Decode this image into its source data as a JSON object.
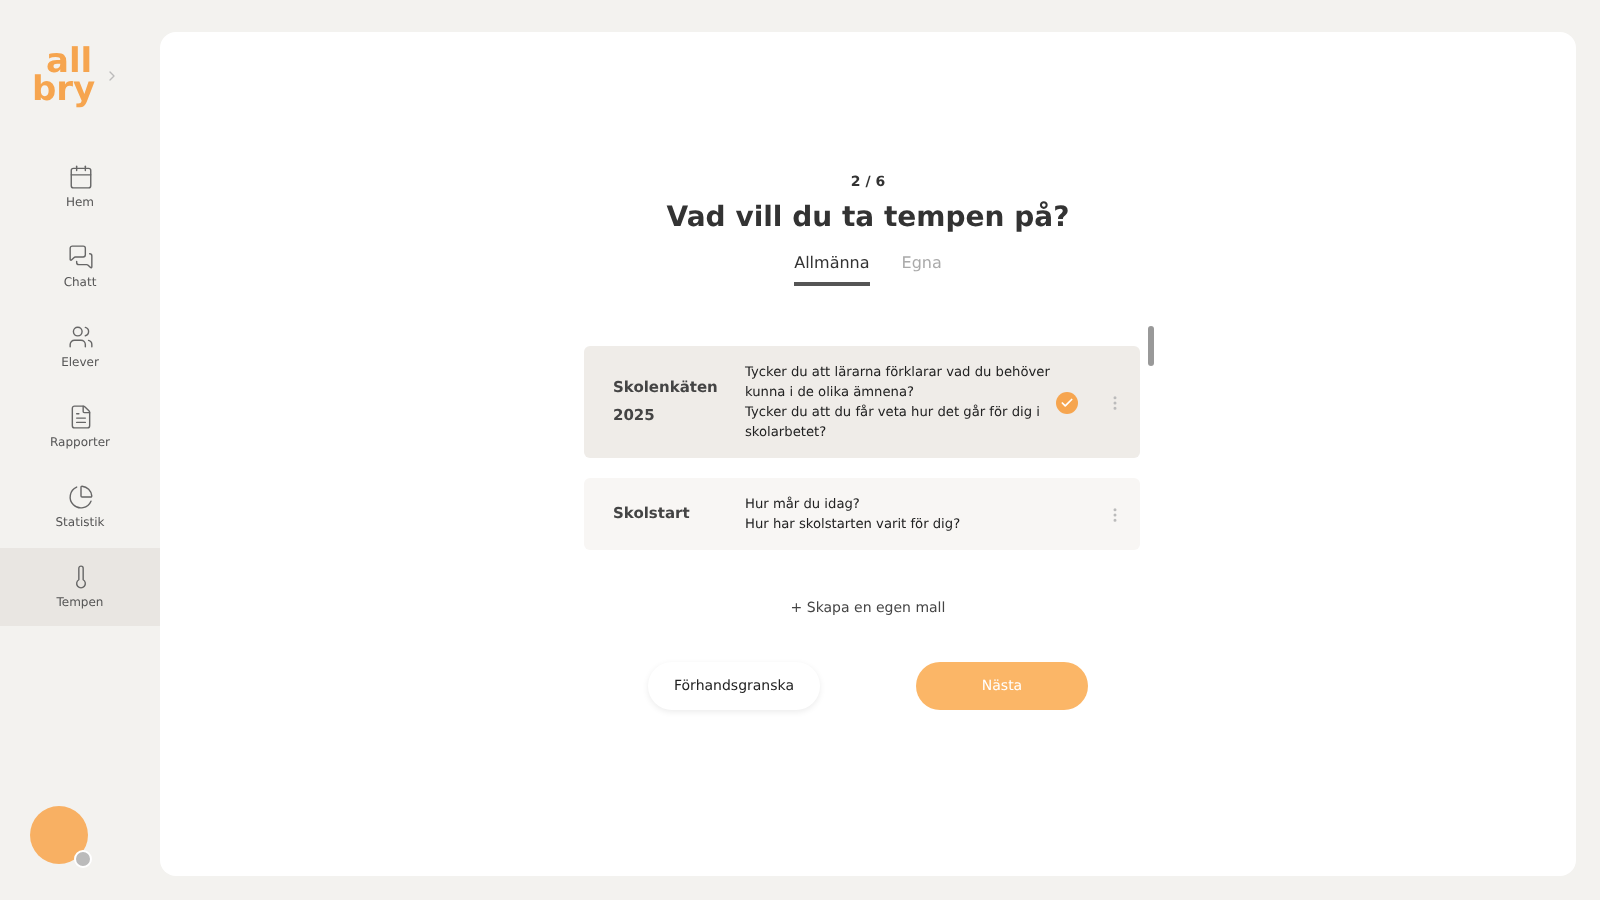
{
  "logo": {
    "line_1": "all",
    "line_2": "bry"
  },
  "sidebar": {
    "items": [
      {
        "label": "Hem",
        "selected": false
      },
      {
        "label": "Chatt",
        "selected": false
      },
      {
        "label": "Elever",
        "selected": false
      },
      {
        "label": "Rapporter",
        "selected": false
      },
      {
        "label": "Statistik",
        "selected": false
      },
      {
        "label": "Tempen",
        "selected": true
      }
    ]
  },
  "step": "2 / 6",
  "title": "Vad vill du ta tempen på?",
  "tabs": [
    {
      "label": "Allmänna",
      "selected": true
    },
    {
      "label": "Egna",
      "selected": false
    }
  ],
  "templates": [
    {
      "name": "Skolenkäten 2025",
      "questions": [
        "Tycker du att lärarna förklarar vad du behöver kunna i de olika ämnena?",
        "Tycker du att du får veta hur det går för dig i skolarbetet?"
      ],
      "selected": true
    },
    {
      "name": "Skolstart",
      "questions": [
        "Hur mår du idag?",
        "Hur har skolstarten varit för dig?"
      ],
      "selected": false
    }
  ],
  "create_link": "+ Skapa en egen mall",
  "buttons": {
    "preview": "Förhandsgranska",
    "next": "Nästa"
  }
}
